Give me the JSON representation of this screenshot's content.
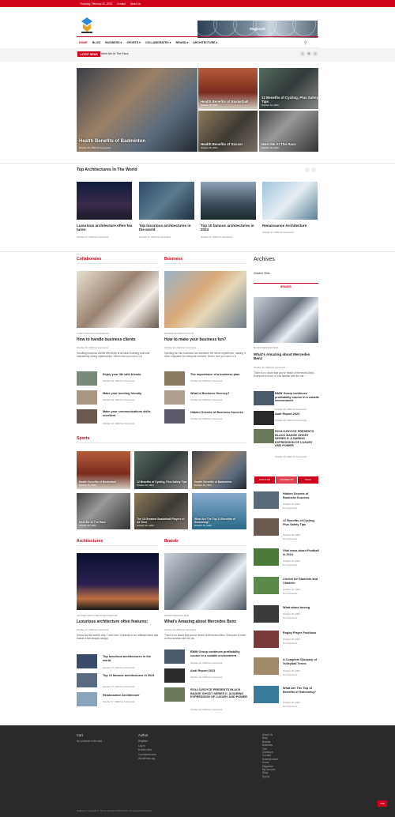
{
  "topbar": {
    "date": "Thursday, February 20, 2025",
    "contact": "Contact",
    "about": "About Us"
  },
  "header": {
    "banner": "Magbook"
  },
  "nav": {
    "items": [
      "HOME",
      "BLOG",
      "BUSINESS ▾",
      "SPORTS ▾",
      "COLLABORATES ▾",
      "BRAND ▾",
      "ARCHITECTURE ▾"
    ],
    "search_icon": "search-icon"
  },
  "ticker": {
    "label": "LATEST NEWS",
    "text": "Meet Me At The Race"
  },
  "hero": {
    "main": {
      "title": "Health Benefits of Badminton",
      "meta": "October 16, 2024   No Comments"
    },
    "t1": {
      "title": "Health Benefits of Basketball",
      "meta": "October 16, 2024"
    },
    "t2": {
      "title": "12 Benefits of Cycling, Plus Safety Tips",
      "meta": "October 16, 2024"
    },
    "t3": {
      "title": "Health Benefits of Soccer",
      "meta": "October 16, 2024"
    },
    "t4": {
      "title": "Meet Me At The Race",
      "meta": "October 16, 2024"
    }
  },
  "top_arch": {
    "title": "Top Architectures In The World",
    "cards": [
      {
        "title": "Luxurious architecture often fea tures:",
        "meta": "October 17, 2024   No Comments"
      },
      {
        "title": "Top luxurious architectures in the world",
        "meta": "October 17, 2024   No Comments"
      },
      {
        "title": "Top 10 famous architectures in 2024",
        "meta": "October 17, 2024   No Comments"
      },
      {
        "title": "Renaissance Architecture",
        "meta": "October 17, 2024   No Comments"
      }
    ]
  },
  "collab": {
    "title": "Collaborates",
    "main_title": "How to handle business clients",
    "tag": "CLIENT HANDLING   COLLABORATES",
    "meta": "October 16, 2024   No Comments",
    "excerpt": "Handling business clients effectively is all about building trust and maintaining strong relationships. Here's how you can d o it:",
    "list": [
      {
        "title": "Enjoy your life with friends",
        "meta": "October 16, 2024   No Comments"
      },
      {
        "title": "Make your meeting friendly",
        "meta": "October 16, 2024   No Comments"
      },
      {
        "title": "Make your communications skills excellent",
        "meta": "October 16, 2024   No Comments"
      }
    ]
  },
  "business": {
    "title": "Business",
    "main_title": "How to make your business fun?",
    "tag": "BUSINESS   BUSINESS WITH FUN",
    "meta": "October 16, 2024   No Comments",
    "excerpt": "Injecting fun into business can transform the whole experience, making it more enjoyable for everyone involved. Here's how you can d o it:",
    "list": [
      {
        "title": "The importance of a business plan",
        "meta": "October 16, 2024   No Comments"
      },
      {
        "title": "What is Business Secrecy?",
        "meta": "October 16, 2024   No Comments"
      },
      {
        "title": "Hidden Secrets of Business Success",
        "meta": "October 16, 2024   No Comments"
      }
    ]
  },
  "sports": {
    "title": "Sports",
    "tiles": [
      {
        "title": "Health Benefits of Basketball",
        "meta": "October 16, 2024"
      },
      {
        "title": "12 Benefits of Cycling, Plus Safety Tips",
        "meta": "October 16, 2024"
      },
      {
        "title": "Health Benefits of Badminton",
        "meta": "October 16, 2024"
      },
      {
        "title": "Meet Me At The Race",
        "meta": "October 16, 2024"
      },
      {
        "title": "The 10 Greatest Basketball Players of All Time",
        "meta": "October 16, 2024"
      },
      {
        "title": "What Are The Top 12 Benefits of Swimming?",
        "meta": "October 16, 2024"
      }
    ]
  },
  "archs": {
    "title": "Architectures",
    "main_title": "Luxurious architecture often features:",
    "tag": "ARCHITECTURES   INTERIOR ARCHITECTURE",
    "meta": "October 17, 2024   No Comments",
    "excerpt": "Known as the world's only 7-star hotel, it stands on an artificial island and boasts a sail-shaped design.",
    "list": [
      {
        "title": "Top luxurious architectures in the world",
        "meta": "October 17, 2024   No Comments"
      },
      {
        "title": "Top 10 famous architectures in 2024",
        "meta": "October 17, 2024   No Comments"
      },
      {
        "title": "Renaissance Architecture",
        "meta": "October 17, 2024   No Comments"
      }
    ]
  },
  "brands": {
    "title": "Brands",
    "main_title": "What's Amazing about Mercedes Benz",
    "tag": "BRANDS   MERCEDES BENZ",
    "meta": "October 16, 2024   No Comments",
    "excerpt": "There is no doubt that you've heard of Mercedes-Benz. Everyone is more or less familiar with the car ...",
    "list": [
      {
        "title": "BMW Group continues profitability course in a volatile environment",
        "meta": "October 16, 2024   No Comments"
      },
      {
        "title": "Audi Report 2023",
        "meta": "October 16, 2024   No Comments"
      },
      {
        "title": "ROLLS-ROYCE PRESENTS BLACK BADGE GHOST SERIES II: A DARING EXPRESSION OF LUXURY AND POWER",
        "meta": "October 16, 2024   No Comments"
      }
    ]
  },
  "sidebar": {
    "archives_title": "Archives",
    "archive": "October 2024",
    "brands_label": "BRANDS",
    "featured": {
      "tag": "BRANDS   MERCEDES BENZ",
      "title": "What's Amazing about Mercedes Benz",
      "meta": "October 16, 2024   No Comments",
      "excerpt": "There is no doubt that you've heard of Mercedes-Benz. Everyone is more or less familiar with the car ..."
    },
    "brand_list": [
      {
        "title": "BMW Group continues profitability course in a volatile environment",
        "meta": "October 16, 2024   No Comments"
      },
      {
        "title": "Audi Report 2023",
        "meta": "October 16, 2024   No Comments"
      },
      {
        "title": "ROLLS-ROYCE PRESENTS BLACK BADGE GHOST SERIES II: A DARING EXPRESSION OF LUXURY AND POWER",
        "meta": "October 16, 2024   No Comments"
      }
    ],
    "tabs": [
      "POPULAR",
      "COMMENTS",
      "TAGS"
    ],
    "popular": [
      {
        "title": "Hidden Secrets of Business Success",
        "meta": "October 16, 2024",
        "c": "No Comments"
      },
      {
        "title": "12 Benefits of Cycling, Plus Safety Tips",
        "meta": "October 16, 2024",
        "c": "No Comments"
      },
      {
        "title": "Vital news about Football in 2024",
        "meta": "October 16, 2024",
        "c": "No Comments"
      },
      {
        "title": "Cricket for Students and Children",
        "meta": "October 16, 2024",
        "c": "No Comments"
      },
      {
        "title": "What about boxing",
        "meta": "October 16, 2024",
        "c": "No Comments"
      },
      {
        "title": "Rugby Player Positions",
        "meta": "October 16, 2024",
        "c": "No Comments"
      },
      {
        "title": "A Complete Glossary of Volleyball Terms",
        "meta": "October 16, 2024",
        "c": "No Comments"
      },
      {
        "title": "What Are The Top 12 Benefits of Swimming?",
        "meta": "October 16, 2024",
        "c": "No Comments"
      }
    ]
  },
  "footer": {
    "cart_title": "Cart",
    "cart_text": "No products in the cart.",
    "author_title": "Author",
    "author_links": [
      "Register",
      "Log in",
      "Entries feed",
      "Comments feed",
      "WordPress.org"
    ],
    "pages": [
      "About Us",
      "Blog",
      "Brands",
      "Business",
      "Cart",
      "Checkout",
      "Contact",
      "Entertainment",
      "Home",
      "Magazine",
      "My account",
      "Shop",
      "Sports"
    ],
    "copy": "Magbook | Copyright © Theme Freesia | WordPress | All Copyright Reserved",
    "top": "TOP"
  }
}
